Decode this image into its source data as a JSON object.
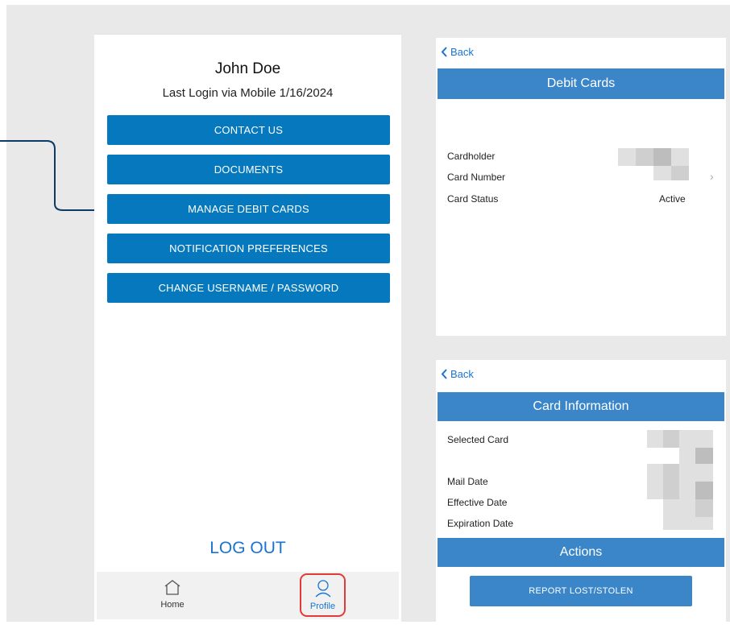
{
  "profile": {
    "user_name": "John Doe",
    "last_login": "Last Login via Mobile 1/16/2024",
    "menu": [
      {
        "label": "CONTACT US"
      },
      {
        "label": "DOCUMENTS"
      },
      {
        "label": "MANAGE DEBIT CARDS"
      },
      {
        "label": "NOTIFICATION PREFERENCES"
      },
      {
        "label": "CHANGE USERNAME / PASSWORD"
      }
    ],
    "logout_label": "LOG OUT",
    "tabs": [
      {
        "label": "Home",
        "icon": "home-icon"
      },
      {
        "label": "Profile",
        "icon": "profile-icon",
        "active": true
      }
    ]
  },
  "debit_cards": {
    "back_label": "Back",
    "title": "Debit Cards",
    "rows": [
      {
        "label": "Cardholder",
        "value": ""
      },
      {
        "label": "Card Number",
        "value": ""
      },
      {
        "label": "Card Status",
        "value": "Active"
      }
    ]
  },
  "card_info": {
    "back_label": "Back",
    "title": "Card Information",
    "rows": [
      {
        "label": "Selected Card"
      },
      {
        "label": "Mail Date"
      },
      {
        "label": "Effective Date"
      },
      {
        "label": "Expiration Date"
      }
    ],
    "actions_title": "Actions",
    "report_label": "REPORT LOST/STOLEN"
  },
  "colors": {
    "primary_button": "#0679be",
    "panel_bar": "#3a86c8",
    "link": "#1a73d1",
    "highlight": "#e53935",
    "callout_line": "#0d3a66"
  }
}
